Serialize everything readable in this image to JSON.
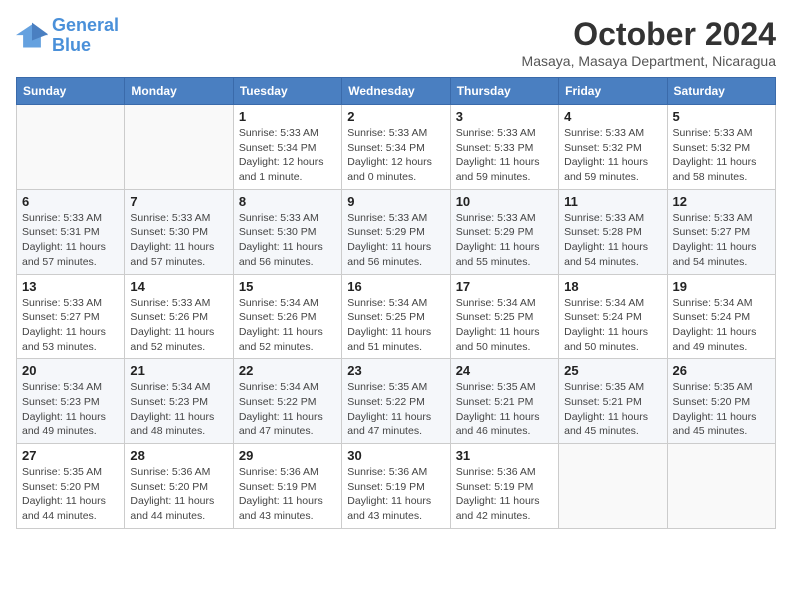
{
  "logo": {
    "line1": "General",
    "line2": "Blue"
  },
  "title": "October 2024",
  "location": "Masaya, Masaya Department, Nicaragua",
  "days_of_week": [
    "Sunday",
    "Monday",
    "Tuesday",
    "Wednesday",
    "Thursday",
    "Friday",
    "Saturday"
  ],
  "weeks": [
    [
      {
        "day": "",
        "info": ""
      },
      {
        "day": "",
        "info": ""
      },
      {
        "day": "1",
        "info": "Sunrise: 5:33 AM\nSunset: 5:34 PM\nDaylight: 12 hours and 1 minute."
      },
      {
        "day": "2",
        "info": "Sunrise: 5:33 AM\nSunset: 5:34 PM\nDaylight: 12 hours and 0 minutes."
      },
      {
        "day": "3",
        "info": "Sunrise: 5:33 AM\nSunset: 5:33 PM\nDaylight: 11 hours and 59 minutes."
      },
      {
        "day": "4",
        "info": "Sunrise: 5:33 AM\nSunset: 5:32 PM\nDaylight: 11 hours and 59 minutes."
      },
      {
        "day": "5",
        "info": "Sunrise: 5:33 AM\nSunset: 5:32 PM\nDaylight: 11 hours and 58 minutes."
      }
    ],
    [
      {
        "day": "6",
        "info": "Sunrise: 5:33 AM\nSunset: 5:31 PM\nDaylight: 11 hours and 57 minutes."
      },
      {
        "day": "7",
        "info": "Sunrise: 5:33 AM\nSunset: 5:30 PM\nDaylight: 11 hours and 57 minutes."
      },
      {
        "day": "8",
        "info": "Sunrise: 5:33 AM\nSunset: 5:30 PM\nDaylight: 11 hours and 56 minutes."
      },
      {
        "day": "9",
        "info": "Sunrise: 5:33 AM\nSunset: 5:29 PM\nDaylight: 11 hours and 56 minutes."
      },
      {
        "day": "10",
        "info": "Sunrise: 5:33 AM\nSunset: 5:29 PM\nDaylight: 11 hours and 55 minutes."
      },
      {
        "day": "11",
        "info": "Sunrise: 5:33 AM\nSunset: 5:28 PM\nDaylight: 11 hours and 54 minutes."
      },
      {
        "day": "12",
        "info": "Sunrise: 5:33 AM\nSunset: 5:27 PM\nDaylight: 11 hours and 54 minutes."
      }
    ],
    [
      {
        "day": "13",
        "info": "Sunrise: 5:33 AM\nSunset: 5:27 PM\nDaylight: 11 hours and 53 minutes."
      },
      {
        "day": "14",
        "info": "Sunrise: 5:33 AM\nSunset: 5:26 PM\nDaylight: 11 hours and 52 minutes."
      },
      {
        "day": "15",
        "info": "Sunrise: 5:34 AM\nSunset: 5:26 PM\nDaylight: 11 hours and 52 minutes."
      },
      {
        "day": "16",
        "info": "Sunrise: 5:34 AM\nSunset: 5:25 PM\nDaylight: 11 hours and 51 minutes."
      },
      {
        "day": "17",
        "info": "Sunrise: 5:34 AM\nSunset: 5:25 PM\nDaylight: 11 hours and 50 minutes."
      },
      {
        "day": "18",
        "info": "Sunrise: 5:34 AM\nSunset: 5:24 PM\nDaylight: 11 hours and 50 minutes."
      },
      {
        "day": "19",
        "info": "Sunrise: 5:34 AM\nSunset: 5:24 PM\nDaylight: 11 hours and 49 minutes."
      }
    ],
    [
      {
        "day": "20",
        "info": "Sunrise: 5:34 AM\nSunset: 5:23 PM\nDaylight: 11 hours and 49 minutes."
      },
      {
        "day": "21",
        "info": "Sunrise: 5:34 AM\nSunset: 5:23 PM\nDaylight: 11 hours and 48 minutes."
      },
      {
        "day": "22",
        "info": "Sunrise: 5:34 AM\nSunset: 5:22 PM\nDaylight: 11 hours and 47 minutes."
      },
      {
        "day": "23",
        "info": "Sunrise: 5:35 AM\nSunset: 5:22 PM\nDaylight: 11 hours and 47 minutes."
      },
      {
        "day": "24",
        "info": "Sunrise: 5:35 AM\nSunset: 5:21 PM\nDaylight: 11 hours and 46 minutes."
      },
      {
        "day": "25",
        "info": "Sunrise: 5:35 AM\nSunset: 5:21 PM\nDaylight: 11 hours and 45 minutes."
      },
      {
        "day": "26",
        "info": "Sunrise: 5:35 AM\nSunset: 5:20 PM\nDaylight: 11 hours and 45 minutes."
      }
    ],
    [
      {
        "day": "27",
        "info": "Sunrise: 5:35 AM\nSunset: 5:20 PM\nDaylight: 11 hours and 44 minutes."
      },
      {
        "day": "28",
        "info": "Sunrise: 5:36 AM\nSunset: 5:20 PM\nDaylight: 11 hours and 44 minutes."
      },
      {
        "day": "29",
        "info": "Sunrise: 5:36 AM\nSunset: 5:19 PM\nDaylight: 11 hours and 43 minutes."
      },
      {
        "day": "30",
        "info": "Sunrise: 5:36 AM\nSunset: 5:19 PM\nDaylight: 11 hours and 43 minutes."
      },
      {
        "day": "31",
        "info": "Sunrise: 5:36 AM\nSunset: 5:19 PM\nDaylight: 11 hours and 42 minutes."
      },
      {
        "day": "",
        "info": ""
      },
      {
        "day": "",
        "info": ""
      }
    ]
  ]
}
